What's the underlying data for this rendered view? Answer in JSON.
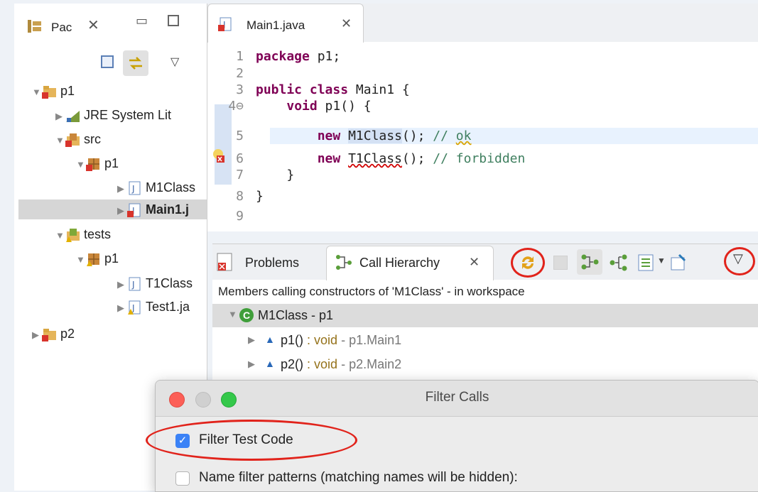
{
  "package_explorer": {
    "tab_label": "Pac",
    "tree": [
      {
        "label": "p1",
        "bold": false
      },
      {
        "label": "JRE System Lit",
        "bold": false
      },
      {
        "label": "src",
        "bold": false
      },
      {
        "label": "p1",
        "bold": false
      },
      {
        "label": "M1Class",
        "bold": false
      },
      {
        "label": "Main1.j",
        "bold": true
      },
      {
        "label": "tests",
        "bold": false
      },
      {
        "label": "p1",
        "bold": false
      },
      {
        "label": "T1Class",
        "bold": false
      },
      {
        "label": "Test1.ja",
        "bold": false
      },
      {
        "label": "p2",
        "bold": false
      }
    ]
  },
  "editor": {
    "tab_label": "Main1.java",
    "lines": [
      {
        "n": "1"
      },
      {
        "n": "2"
      },
      {
        "n": "3"
      },
      {
        "n": "4⊖"
      },
      {
        "n": "5"
      },
      {
        "n": "6"
      },
      {
        "n": "7"
      },
      {
        "n": "8"
      },
      {
        "n": "9"
      }
    ]
  },
  "bottom": {
    "problems_tab": "Problems",
    "call_hierarchy_tab": "Call Hierarchy",
    "description": "Members calling constructors of 'M1Class' - in workspace",
    "root": {
      "name": "M1Class",
      "pkg": "- p1"
    },
    "children": [
      {
        "name": "p1()",
        "type": ": void",
        "loc": "- p1.Main1"
      },
      {
        "name": "p2()",
        "type": ": void",
        "loc": "- p2.Main2"
      }
    ]
  },
  "dialog": {
    "title": "Filter Calls",
    "checkbox1_label": "Filter Test Code",
    "checkbox1_checked": true,
    "checkbox2_label": "Name filter patterns (matching names will be hidden):",
    "checkbox2_checked": false
  },
  "colors": {
    "keyword": "#7f0055",
    "comment": "#3f7f5f",
    "annotation_ring": "#e1231b",
    "selection": "#d6d6d6",
    "current_line": "#e8f2fe"
  }
}
